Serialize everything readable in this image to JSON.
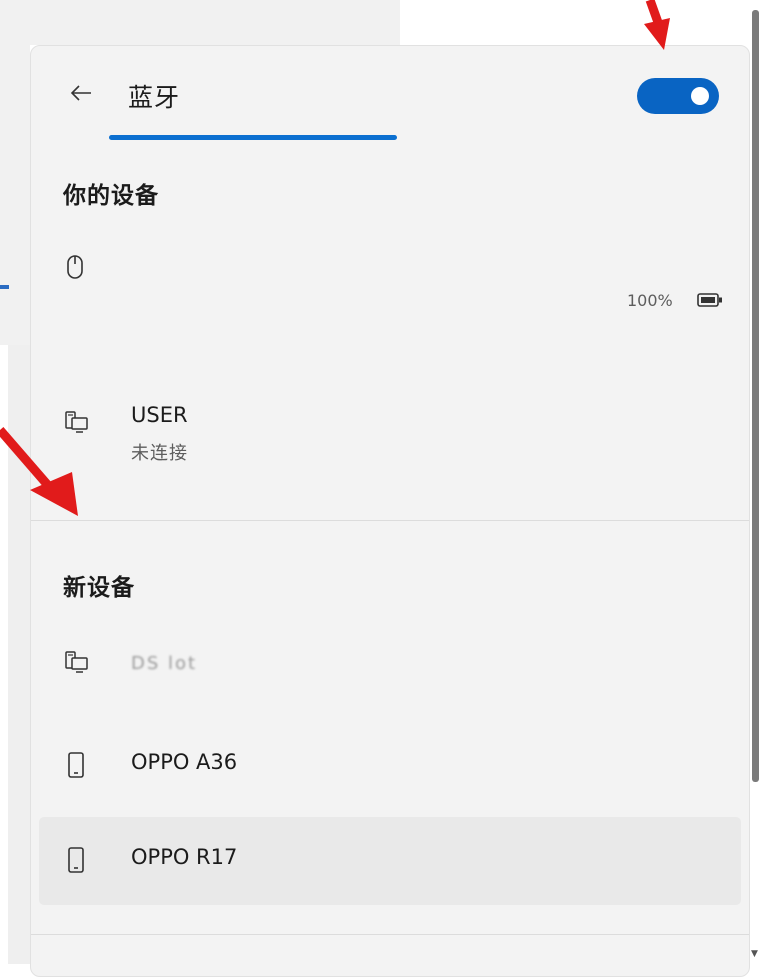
{
  "header": {
    "title": "蓝牙",
    "back_icon": "arrow-left-icon",
    "toggle_on": true
  },
  "sections": {
    "your_devices": "你的设备",
    "new_devices": "新设备"
  },
  "your_devices": [
    {
      "icon": "mouse-icon",
      "name": "",
      "status": "",
      "battery": "100%"
    },
    {
      "icon": "desktop-device-icon",
      "name": "USER",
      "status": "未连接"
    }
  ],
  "new_devices": [
    {
      "icon": "desktop-device-icon",
      "name": "DS lot"
    },
    {
      "icon": "phone-icon",
      "name": "OPPO A36"
    },
    {
      "icon": "phone-icon",
      "name": "OPPO R17"
    }
  ],
  "colors": {
    "accent": "#0964c3",
    "underline": "#0b6fd0",
    "panel_bg": "#f3f3f3",
    "annotation_arrow": "#e11b1b"
  }
}
